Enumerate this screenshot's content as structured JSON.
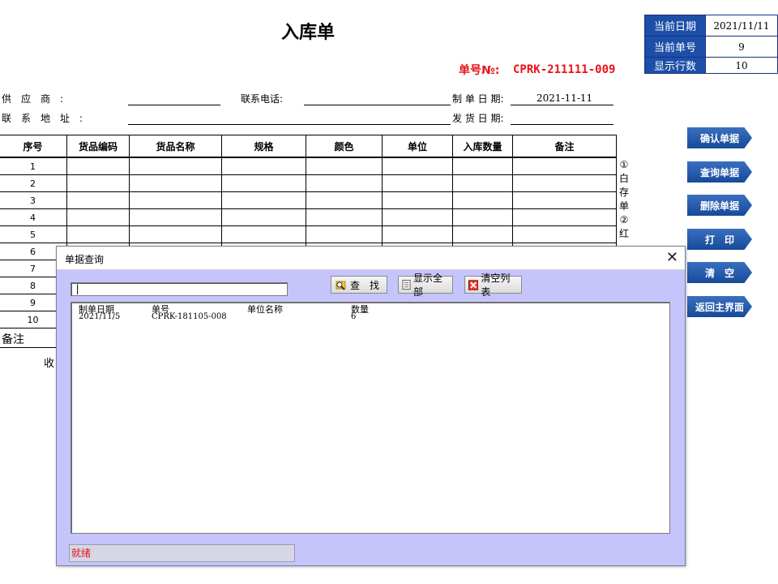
{
  "form": {
    "title": "入库单",
    "number_label": "单号№:",
    "number_value": "CPRK-211111-009",
    "supplier_label": "供　应　商　:",
    "address_label": "联　系　地　址　:",
    "phone_label": "联系电话:",
    "make_date_label": "制 单 日 期:",
    "make_date_value": "2021-11-11",
    "ship_date_label": "发 货 日 期:",
    "remarks_label": "备注",
    "receiver_label": "收"
  },
  "info_panel": {
    "current_date_label": "当前日期",
    "current_date_value": "2021/11/11",
    "current_no_label": "当前单号",
    "current_no_value": "9",
    "rows_label": "显示行数",
    "rows_value": "10"
  },
  "table": {
    "headers": [
      "序号",
      "货品编码",
      "货品名称",
      "规格",
      "颜色",
      "单位",
      "入库数量",
      "备注"
    ],
    "row_numbers": [
      "1",
      "2",
      "3",
      "4",
      "5",
      "6",
      "7",
      "8",
      "9",
      "10"
    ]
  },
  "side_note": "①白存单②红",
  "nav_buttons": [
    "确认单据",
    "查询单据",
    "删除单据",
    "打　印",
    "清　空",
    "返回主界面"
  ],
  "dialog": {
    "title": "单据查询",
    "close_glyph": "✕",
    "search_value": "|",
    "find_label": "查　找",
    "show_all_label": "显示全部",
    "clear_label": "清空列表",
    "columns": [
      "制单日期",
      "单号",
      "单位名称",
      "数量"
    ],
    "rows": [
      {
        "date": "2021/11/5",
        "no": "CPRK-181105-008",
        "unit": "",
        "qty": "6"
      }
    ],
    "status": "就绪"
  }
}
